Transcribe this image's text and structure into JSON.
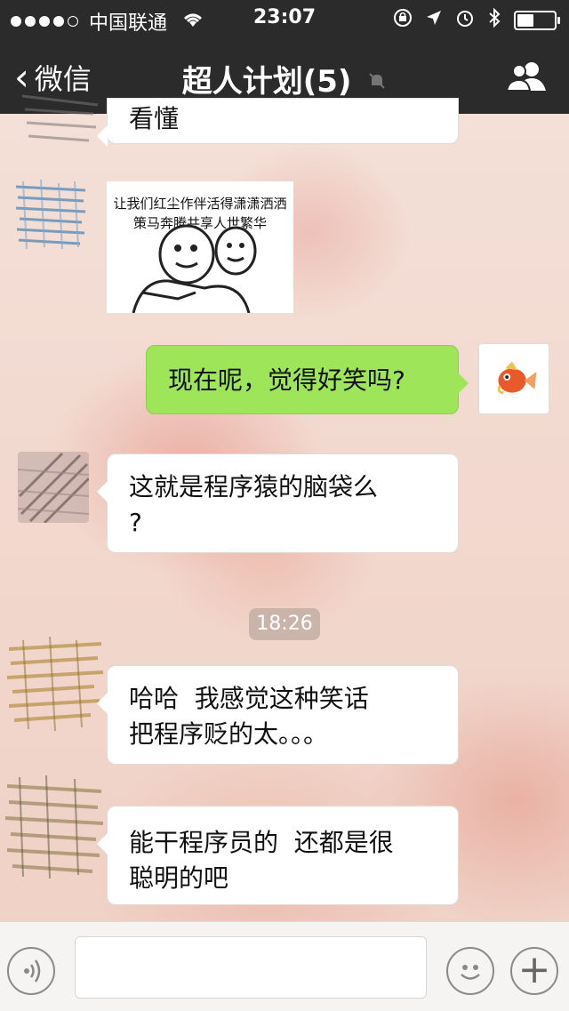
{
  "status_bar": {
    "carrier": "中国联通",
    "time": "23:07"
  },
  "nav": {
    "back_label": "微信",
    "title": "超人计划(5)"
  },
  "messages": [
    {
      "type": "text",
      "side": "left",
      "text": "看懂"
    },
    {
      "type": "image",
      "side": "left",
      "caption_line1": "让我们红尘作伴活得潇潇洒洒",
      "caption_line2": "策马奔腾共享人世繁华"
    },
    {
      "type": "text",
      "side": "right",
      "text": "现在呢，觉得好笑吗?"
    },
    {
      "type": "text",
      "side": "left",
      "line1": "这就是程序猿的脑袋么",
      "line2": "?"
    },
    {
      "type": "timestamp",
      "text": "18:26"
    },
    {
      "type": "text",
      "side": "left",
      "line1": "哈哈  我感觉这种笑话",
      "line2": "把程序贬的太。。。"
    },
    {
      "type": "text",
      "side": "left",
      "line1": "能干程序员的  还都是很",
      "line2": "聪明的吧"
    }
  ],
  "input_bar": {
    "plus_label": "+"
  }
}
